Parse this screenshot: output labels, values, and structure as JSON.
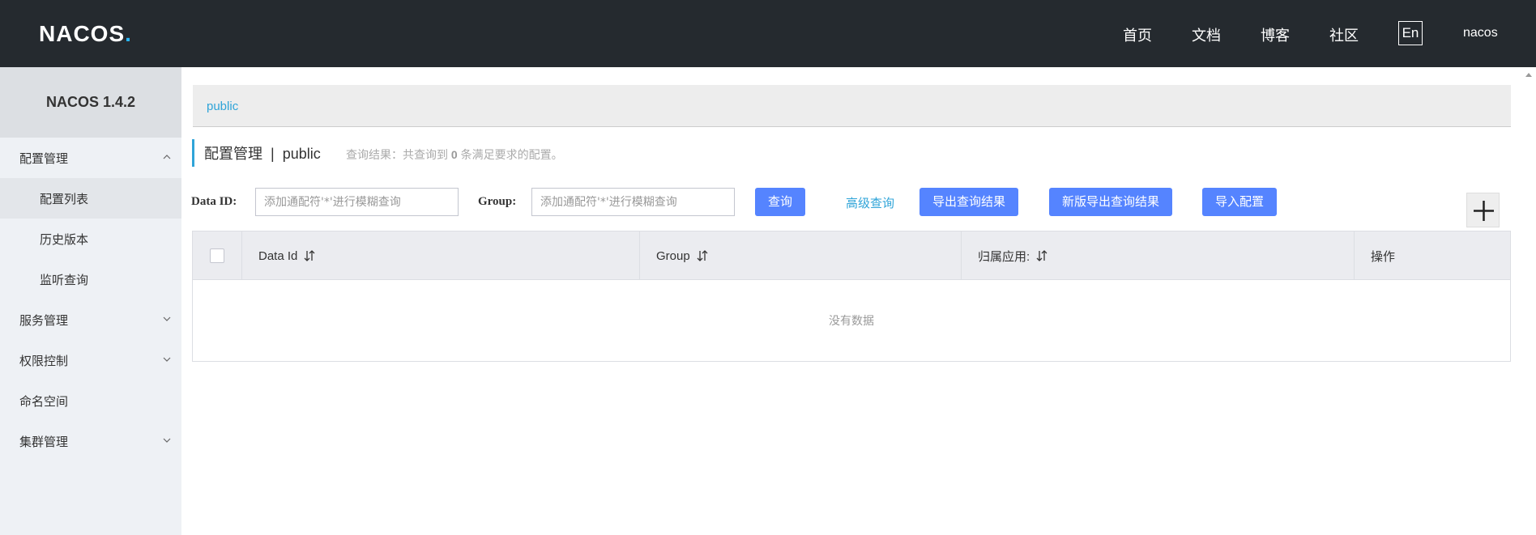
{
  "header": {
    "logo_text": "NACOS",
    "logo_dot": ".",
    "nav": [
      "首页",
      "文档",
      "博客",
      "社区"
    ],
    "lang": "En",
    "user": "nacos"
  },
  "sidebar": {
    "title": "NACOS 1.4.2",
    "items": [
      {
        "label": "配置管理",
        "expanded": true
      },
      {
        "label": "配置列表"
      },
      {
        "label": "历史版本"
      },
      {
        "label": "监听查询"
      },
      {
        "label": "服务管理"
      },
      {
        "label": "权限控制"
      },
      {
        "label": "命名空间"
      },
      {
        "label": "集群管理"
      }
    ]
  },
  "breadcrumb": {
    "namespace": "public"
  },
  "page": {
    "title": "配置管理",
    "separator": "|",
    "namespace": "public",
    "query_prefix": "查询结果：共查询到 ",
    "query_count": "0",
    "query_suffix": " 条满足要求的配置。"
  },
  "search": {
    "dataid_label": "Data ID:",
    "dataid_placeholder": "添加通配符'*'进行模糊查询",
    "group_label": "Group:",
    "group_placeholder": "添加通配符'*'进行模糊查询",
    "query_btn": "查询",
    "advanced_link": "高级查询",
    "export_btn": "导出查询结果",
    "export_new_btn": "新版导出查询结果",
    "import_btn": "导入配置"
  },
  "table": {
    "columns": [
      "Data Id",
      "Group",
      "归属应用:",
      "操作"
    ],
    "empty_text": "没有数据"
  },
  "colors": {
    "header_bg": "#252a2f",
    "accent": "#5584ff",
    "link": "#2fa4d8"
  }
}
